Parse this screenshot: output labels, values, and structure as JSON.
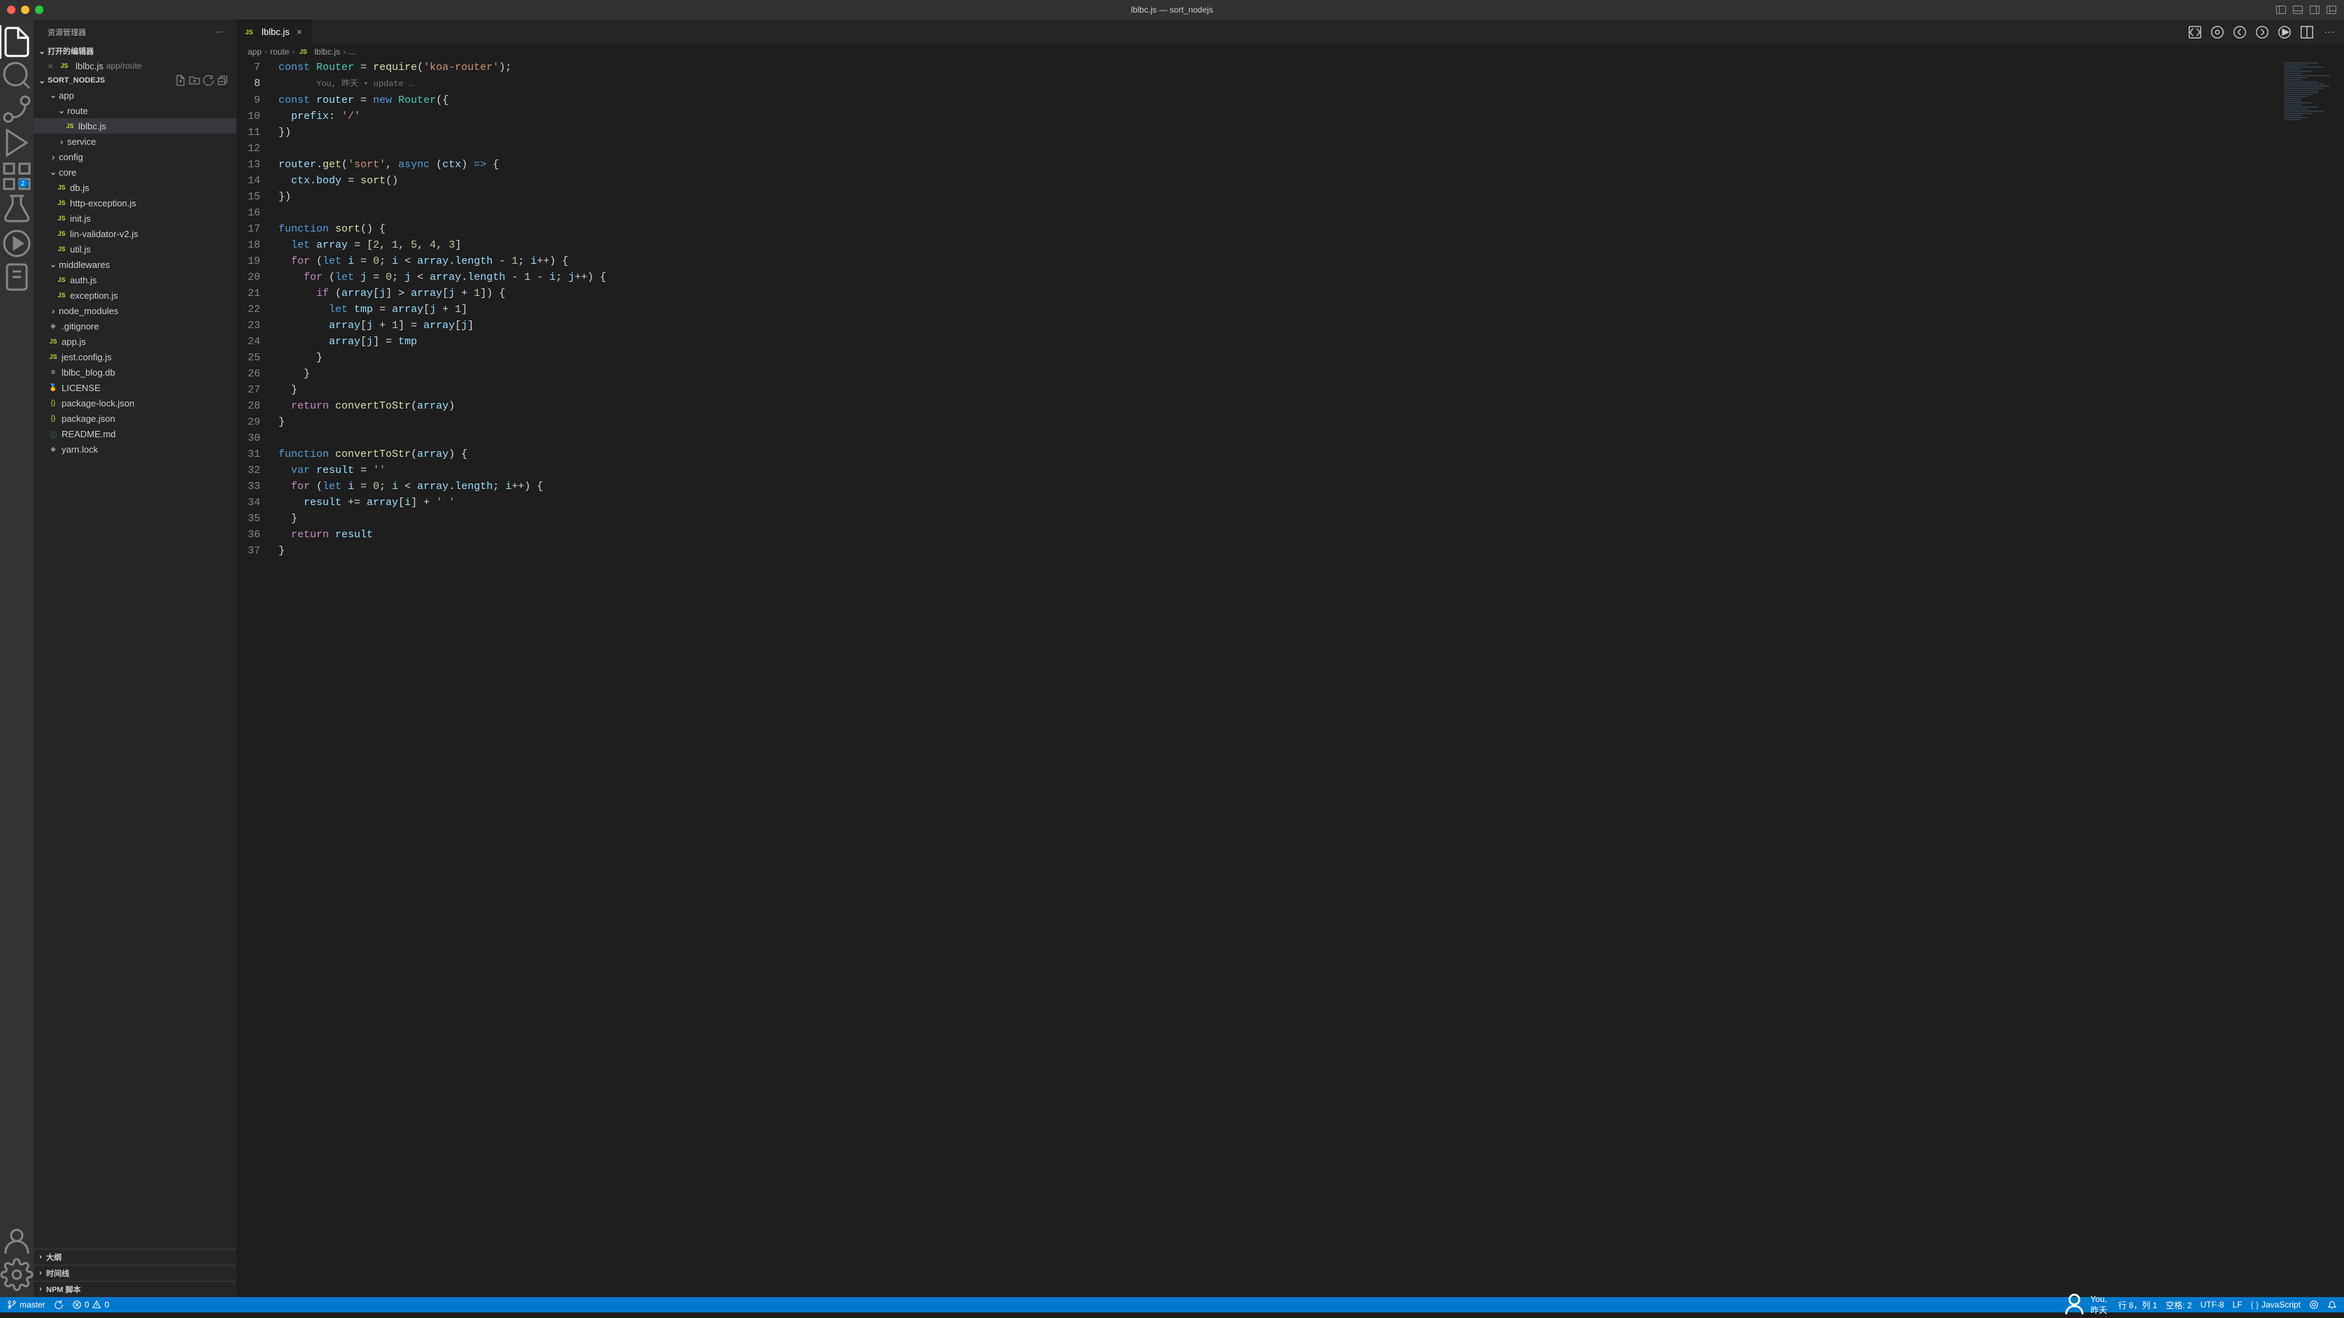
{
  "titlebar": {
    "title": "lblbc.js — sort_nodejs"
  },
  "sidebar": {
    "header": "资源管理器",
    "open_editors_label": "打开的编辑器",
    "open_editors": [
      {
        "name": "lblbc.js",
        "path": "app/route"
      }
    ],
    "project_name": "SORT_NODEJS",
    "tree": {
      "app": "app",
      "route": "route",
      "lblbc": "lblbc.js",
      "service": "service",
      "config": "config",
      "core": "core",
      "db": "db.js",
      "httpexception": "http-exception.js",
      "init": "init.js",
      "linvalidator": "lin-validator-v2.js",
      "util": "util.js",
      "middlewares": "middlewares",
      "auth": "auth.js",
      "exception": "exception.js",
      "node_modules": "node_modules",
      "gitignore": ".gitignore",
      "appjs": "app.js",
      "jestconfig": "jest.config.js",
      "blogdb": "lblbc_blog.db",
      "license": "LICENSE",
      "pkglock": "package-lock.json",
      "pkg": "package.json",
      "readme": "README.md",
      "yarnlock": "yarn.lock"
    },
    "bottom": {
      "outline": "大纲",
      "timeline": "时间线",
      "npm": "NPM 脚本"
    }
  },
  "tab": {
    "name": "lblbc.js"
  },
  "breadcrumbs": {
    "app": "app",
    "route": "route",
    "file": "lblbc.js",
    "more": "..."
  },
  "codelens": "You, 昨天 • update …",
  "code": {
    "l7_a": "const",
    "l7_b": "Router",
    "l7_c": " = ",
    "l7_d": "require",
    "l7_e": "(",
    "l7_f": "'koa-router'",
    "l7_g": ");",
    "l9_a": "const",
    "l9_b": "router",
    "l9_c": " = ",
    "l9_d": "new",
    "l9_e": "Router",
    "l9_f": "({",
    "l10_a": "prefix",
    "l10_b": ": ",
    "l10_c": "'/'",
    "l11": "})",
    "l13_a": "router",
    "l13_b": ".",
    "l13_c": "get",
    "l13_d": "(",
    "l13_e": "'sort'",
    "l13_f": ", ",
    "l13_g": "async",
    "l13_h": " (",
    "l13_i": "ctx",
    "l13_j": ") ",
    "l13_k": "=>",
    "l13_l": " {",
    "l14_a": "ctx",
    "l14_b": ".",
    "l14_c": "body",
    "l14_d": " = ",
    "l14_e": "sort",
    "l14_f": "()",
    "l15": "})",
    "l17_a": "function",
    "l17_b": "sort",
    "l17_c": "() {",
    "l18_a": "let",
    "l18_b": "array",
    "l18_c": " = [",
    "l18_d": "2",
    "l18_e": ", ",
    "l18_f": "1",
    "l18_g": ", ",
    "l18_h": "5",
    "l18_i": ", ",
    "l18_j": "4",
    "l18_k": ", ",
    "l18_l": "3",
    "l18_m": "]",
    "l19_a": "for",
    "l19_b": " (",
    "l19_c": "let",
    "l19_d": "i",
    "l19_e": " = ",
    "l19_f": "0",
    "l19_g": "; ",
    "l19_h": "i",
    "l19_i": " < ",
    "l19_j": "array",
    "l19_k": ".",
    "l19_l": "length",
    "l19_m": " - ",
    "l19_n": "1",
    "l19_o": "; ",
    "l19_p": "i",
    "l19_q": "++) {",
    "l20_a": "for",
    "l20_b": " (",
    "l20_c": "let",
    "l20_d": "j",
    "l20_e": " = ",
    "l20_f": "0",
    "l20_g": "; ",
    "l20_h": "j",
    "l20_i": " < ",
    "l20_j": "array",
    "l20_k": ".",
    "l20_l": "length",
    "l20_m": " - ",
    "l20_n": "1",
    "l20_o": " - ",
    "l20_p": "i",
    "l20_q": "; ",
    "l20_r": "j",
    "l20_s": "++) {",
    "l21_a": "if",
    "l21_b": " (",
    "l21_c": "array",
    "l21_d": "[",
    "l21_e": "j",
    "l21_f": "] > ",
    "l21_g": "array",
    "l21_h": "[",
    "l21_i": "j",
    "l21_j": " + ",
    "l21_k": "1",
    "l21_l": "]) {",
    "l22_a": "let",
    "l22_b": "tmp",
    "l22_c": " = ",
    "l22_d": "array",
    "l22_e": "[",
    "l22_f": "j",
    "l22_g": " + ",
    "l22_h": "1",
    "l22_i": "]",
    "l23_a": "array",
    "l23_b": "[",
    "l23_c": "j",
    "l23_d": " + ",
    "l23_e": "1",
    "l23_f": "] = ",
    "l23_g": "array",
    "l23_h": "[",
    "l23_i": "j",
    "l23_j": "]",
    "l24_a": "array",
    "l24_b": "[",
    "l24_c": "j",
    "l24_d": "] = ",
    "l24_e": "tmp",
    "l25": "}",
    "l26": "}",
    "l27": "}",
    "l28_a": "return",
    "l28_b": "convertToStr",
    "l28_c": "(",
    "l28_d": "array",
    "l28_e": ")",
    "l29": "}",
    "l31_a": "function",
    "l31_b": "convertToStr",
    "l31_c": "(",
    "l31_d": "array",
    "l31_e": ") {",
    "l32_a": "var",
    "l32_b": "result",
    "l32_c": " = ",
    "l32_d": "''",
    "l33_a": "for",
    "l33_b": " (",
    "l33_c": "let",
    "l33_d": "i",
    "l33_e": " = ",
    "l33_f": "0",
    "l33_g": "; ",
    "l33_h": "i",
    "l33_i": " < ",
    "l33_j": "array",
    "l33_k": ".",
    "l33_l": "length",
    "l33_m": "; ",
    "l33_n": "i",
    "l33_o": "++) {",
    "l34_a": "result",
    "l34_b": " += ",
    "l34_c": "array",
    "l34_d": "[",
    "l34_e": "i",
    "l34_f": "] + ",
    "l34_g": "' '",
    "l35": "}",
    "l36_a": "return",
    "l36_b": "result",
    "l37": "}"
  },
  "statusbar": {
    "branch": "master",
    "errors": "0",
    "warnings": "0",
    "blame": "You, 昨天",
    "line_col": "行 8，列 1",
    "spaces": "空格: 2",
    "encoding": "UTF-8",
    "eol": "LF",
    "lang": "JavaScript"
  },
  "activity_badge": "2"
}
